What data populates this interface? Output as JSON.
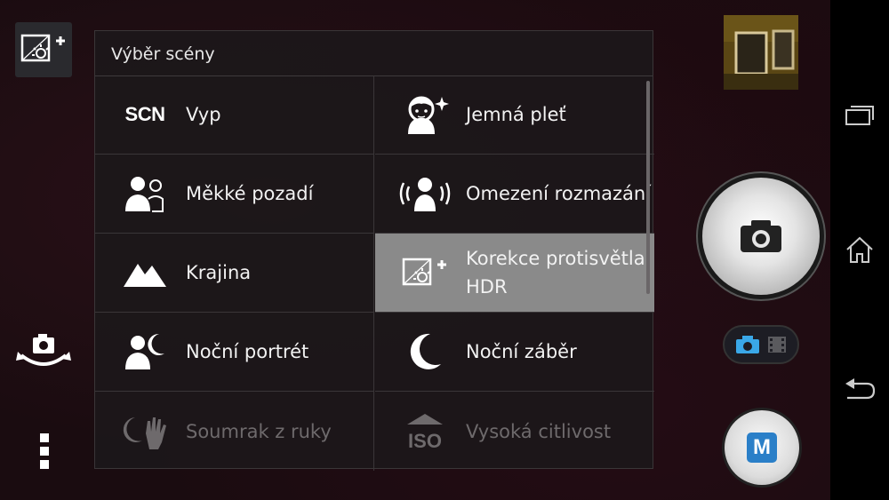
{
  "scene_panel": {
    "title": "Výběr scény",
    "items": [
      {
        "label": "Vyp",
        "icon": "scn-icon",
        "state": "normal"
      },
      {
        "label": "Jemná pleť",
        "icon": "soft-skin-icon",
        "state": "normal"
      },
      {
        "label": "Měkké pozadí",
        "icon": "soft-snap-icon",
        "state": "normal"
      },
      {
        "label": "Omezení rozmazání",
        "icon": "anti-motion-blur-icon",
        "state": "normal"
      },
      {
        "label": "Krajina",
        "icon": "landscape-icon",
        "state": "normal"
      },
      {
        "label": "Korekce protisvětla HDR",
        "icon": "backlight-hdr-icon",
        "state": "selected"
      },
      {
        "label": "Noční portrét",
        "icon": "night-portrait-icon",
        "state": "normal"
      },
      {
        "label": "Noční záběr",
        "icon": "night-scene-icon",
        "state": "normal"
      },
      {
        "label": "Soumrak z ruky",
        "icon": "handheld-twilight-icon",
        "state": "disabled"
      },
      {
        "label": "Vysoká citlivost",
        "icon": "high-sensitivity-icon",
        "state": "disabled"
      }
    ],
    "scn_text": "SCN",
    "iso_text": "ISO"
  },
  "camera_controls": {
    "manual_mode_label": "M",
    "active_mode": "photo"
  },
  "colors": {
    "selected_bg": "#8a8a8a",
    "accent_blue": "#2a7fc8"
  }
}
